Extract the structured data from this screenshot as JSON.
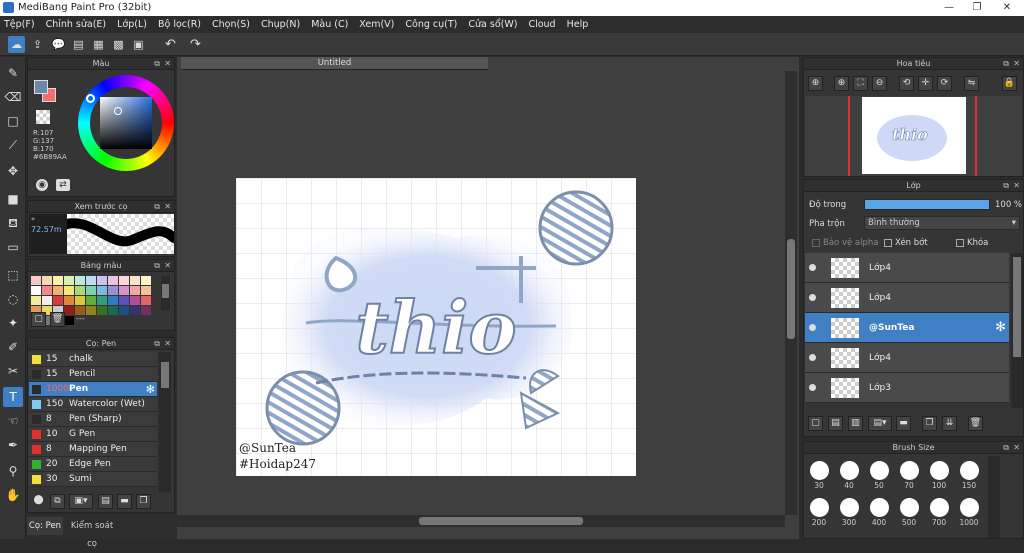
{
  "window": {
    "title": "MediBang Paint Pro (32bit)",
    "min": "—",
    "restore": "❐",
    "close": "✕"
  },
  "menu": [
    "Tệp(F)",
    "Chỉnh sửa(E)",
    "Lớp(L)",
    "Bộ lọc(R)",
    "Chọn(S)",
    "Chụp(N)",
    "Màu (C)",
    "Xem(V)",
    "Công cụ(T)",
    "Cửa sổ(W)",
    "Cloud",
    "Help"
  ],
  "toolbar": {
    "icons": [
      "cloud-icon",
      "upload-icon",
      "comment-icon",
      "file-icon",
      "page-icon",
      "grid-icon",
      "panels-icon",
      "undo-icon",
      "redo-icon"
    ]
  },
  "document": {
    "tab_title": "Untitled",
    "watermark_line1": "@SunTea",
    "watermark_line2": "#Hoidap247",
    "art_text": "thio"
  },
  "color_panel": {
    "title": "Màu",
    "r": "R:107",
    "g": "G:137",
    "b": "B:170",
    "hex": "#6B89AA",
    "primary": "#6B89AA",
    "secondary": "#f07070"
  },
  "brush_preview": {
    "title": "Xem trước cọ",
    "size": "72.57m"
  },
  "palette": {
    "title": "Bảng màu",
    "footer": "---",
    "colors": [
      "#f9c9c9",
      "#f7d8b5",
      "#f9f2a8",
      "#d7f0b1",
      "#b9e9d9",
      "#b9dcf2",
      "#c9c3ec",
      "#ecc1e1",
      "#fbd7d7",
      "#fbe4c8",
      "#fbf6c6",
      "#ffffff",
      "#f08a8a",
      "#f2b07a",
      "#f3e67a",
      "#a8da78",
      "#7fd0b3",
      "#7fb8e0",
      "#9a90d8",
      "#d98fc7",
      "#f3a6a6",
      "#f4c39a",
      "#f6e9a0",
      "#eeeeee",
      "#d63b3b",
      "#e0873a",
      "#d9c93a",
      "#5fae3a",
      "#2f9f7e",
      "#2f7fc0",
      "#5d4fb8",
      "#b14e98",
      "#e06666",
      "#e09a55",
      "#e6d666",
      "#cccccc",
      "#8f2020",
      "#9a5a20",
      "#8f8420",
      "#3a6f20",
      "#1e6552",
      "#1e507d",
      "#3a3175",
      "#703062",
      "#444444",
      "#777777",
      "#aaaaaa",
      "#000000"
    ]
  },
  "brush_panel": {
    "title": "Cọ: Pen",
    "items": [
      {
        "size": "15",
        "name": "chalk",
        "color": "#f2e03a"
      },
      {
        "size": "15",
        "name": "Pencil",
        "color": "#2a2a2a"
      },
      {
        "size": "1000",
        "name": "Pen",
        "color": "#2a2a2a"
      },
      {
        "size": "150",
        "name": "Watercolor (Wet)",
        "color": "#7fc8f0"
      },
      {
        "size": "8",
        "name": "Pen (Sharp)",
        "color": "#2a2a2a"
      },
      {
        "size": "10",
        "name": "G Pen",
        "color": "#e03030"
      },
      {
        "size": "8",
        "name": "Mapping Pen",
        "color": "#e03030"
      },
      {
        "size": "20",
        "name": "Edge Pen",
        "color": "#33b033"
      },
      {
        "size": "30",
        "name": "Sumi",
        "color": "#f2e03a"
      }
    ]
  },
  "bottom_tabs": {
    "tab1": "Cọ: Pen",
    "tab2": "Kiểm soát cọ"
  },
  "navigator": {
    "title": "Hoa tiêu"
  },
  "layer_panel": {
    "title": "Lớp",
    "opacity_label": "Độ trong",
    "opacity_value": "100 %",
    "blend_label": "Pha trộn",
    "blend_value": "Bình thường",
    "protect_alpha": "Bảo vệ alpha",
    "clipping": "Xén bớt",
    "lock": "Khóa",
    "layers": [
      {
        "name": "Lớp4",
        "active": false
      },
      {
        "name": "Lớp4",
        "active": false
      },
      {
        "name": "@SunTea",
        "active": true
      },
      {
        "name": "Lớp4",
        "active": false
      },
      {
        "name": "Lớp3",
        "active": false
      }
    ]
  },
  "brush_size": {
    "title": "Brush Size",
    "sizes": [
      "30",
      "40",
      "50",
      "70",
      "100",
      "150",
      "200",
      "300",
      "400",
      "500",
      "700",
      "1000"
    ]
  }
}
